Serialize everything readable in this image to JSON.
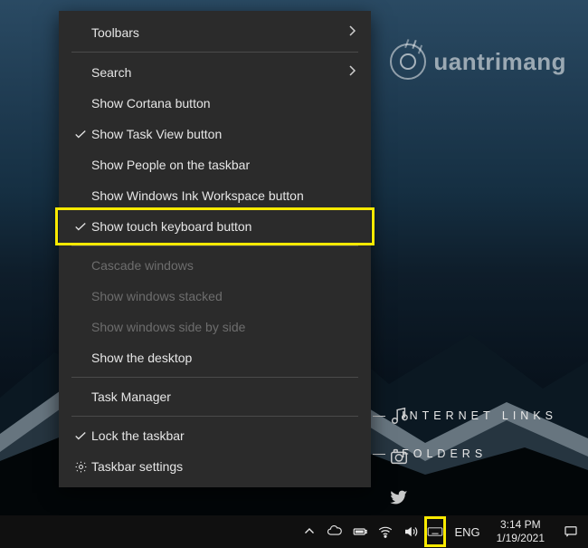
{
  "watermark": {
    "text": "uantrimang"
  },
  "desktop_labels": {
    "links": "INTERNET LINKS",
    "folders": "FOLDERS"
  },
  "context_menu": {
    "toolbars": "Toolbars",
    "search": "Search",
    "show_cortana": "Show Cortana button",
    "show_task_view": "Show Task View button",
    "show_people": "Show People on the taskbar",
    "show_ink": "Show Windows Ink Workspace button",
    "show_touch_kb": "Show touch keyboard button",
    "cascade": "Cascade windows",
    "stacked": "Show windows stacked",
    "sidebyside": "Show windows side by side",
    "show_desktop": "Show the desktop",
    "task_manager": "Task Manager",
    "lock_taskbar": "Lock the taskbar",
    "taskbar_settings": "Taskbar settings"
  },
  "taskbar": {
    "lang": "ENG",
    "time": "3:14 PM",
    "date": "1/19/2021"
  },
  "colors": {
    "highlight": "#f9ea00",
    "menu_bg": "#2b2b2b"
  }
}
